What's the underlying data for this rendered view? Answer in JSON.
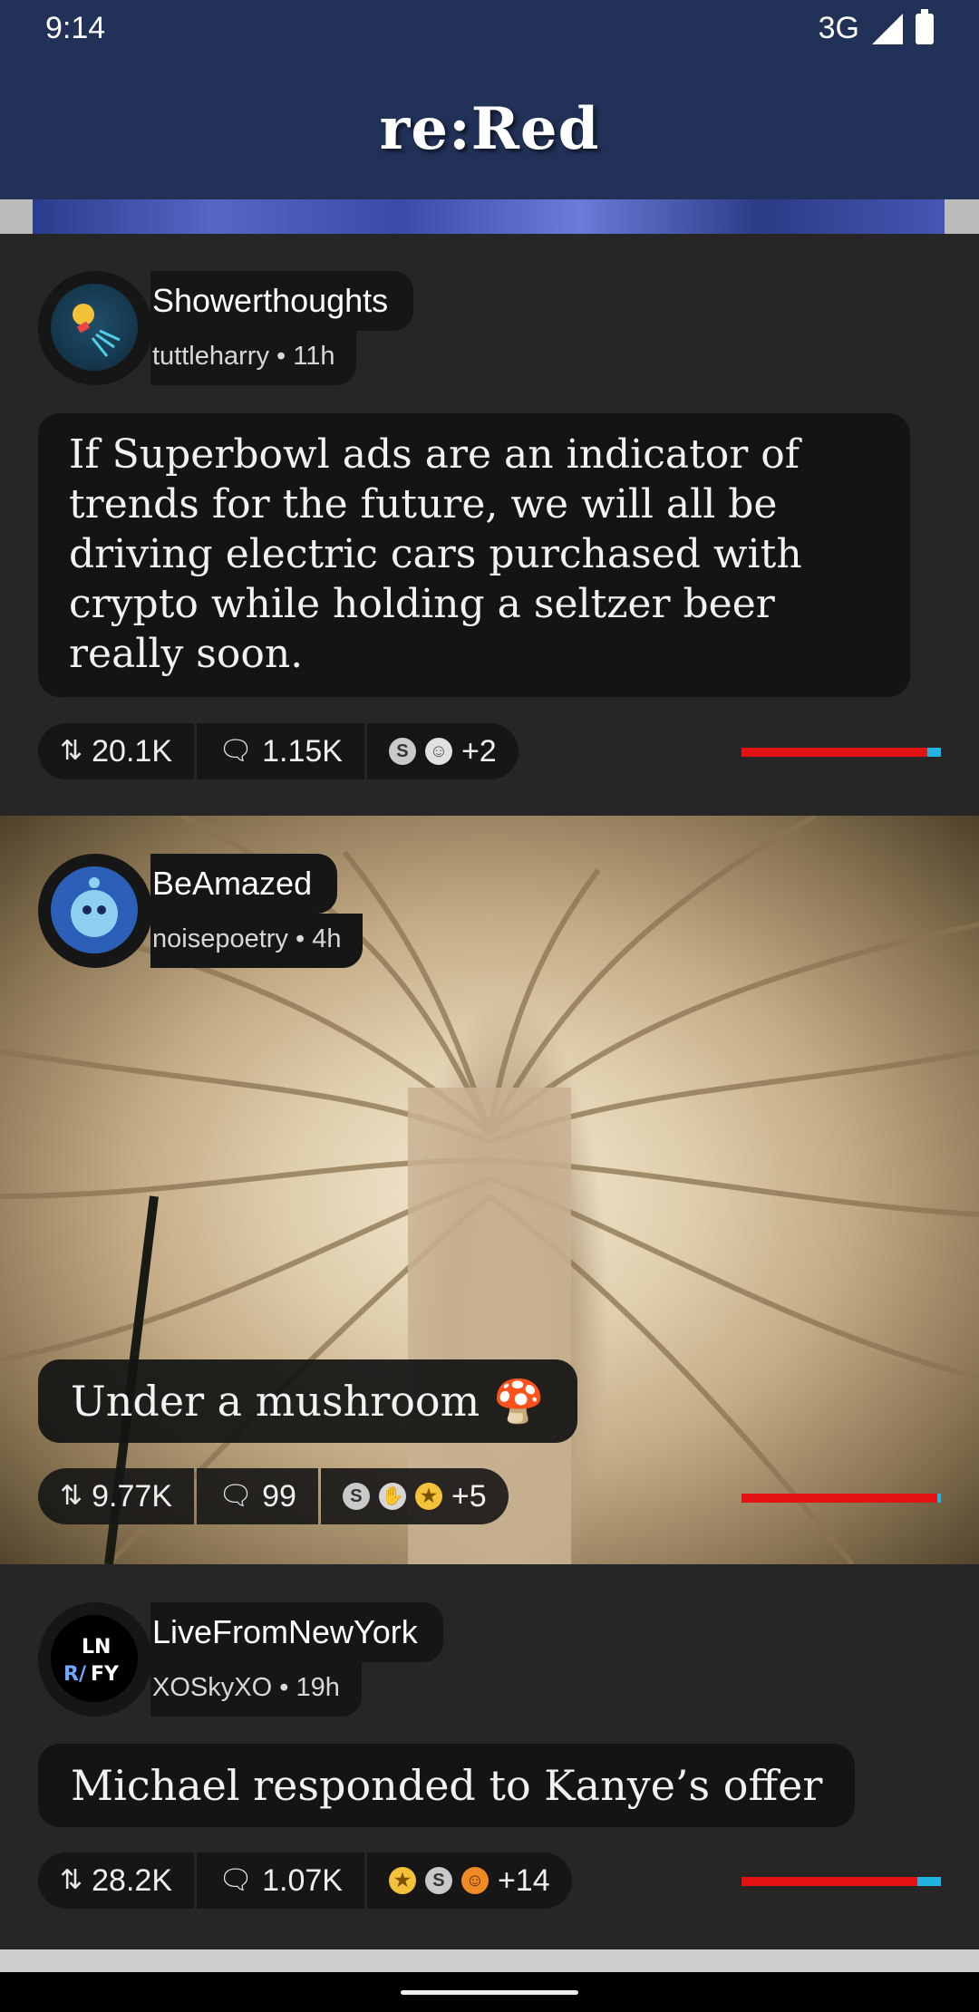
{
  "status": {
    "time": "9:14",
    "network": "3G"
  },
  "app": {
    "title": "re:Red"
  },
  "posts": [
    {
      "subreddit": "Showerthoughts",
      "author": "tuttleharry",
      "age": "11h",
      "title": "If Superbowl ads are an indicator of trends for the future, we will all be driving electric cars purchased with crypto while holding a seltzer beer really soon.",
      "score": "20.1K",
      "comments": "1.15K",
      "awards_more": "+2",
      "upvote_ratio": 0.93
    },
    {
      "subreddit": "BeAmazed",
      "author": "noisepoetry",
      "age": "4h",
      "title": "Under a mushroom 🍄",
      "score": "9.77K",
      "comments": "99",
      "awards_more": "+5",
      "upvote_ratio": 0.98
    },
    {
      "subreddit": "LiveFromNewYork",
      "author": "XOSkyXO",
      "age": "19h",
      "title": "Michael responded to Kanye’s offer",
      "score": "28.2K",
      "comments": "1.07K",
      "awards_more": "+14",
      "upvote_ratio": 0.88
    }
  ],
  "colors": {
    "appbar": "#223158",
    "ratio_up": "#e31313",
    "ratio_down": "#22b4e0",
    "feed_bg": "#262626"
  },
  "icons": [
    "score-arrows-icon",
    "comment-icon",
    "silver-award-icon",
    "wholesome-award-icon",
    "helpful-award-icon",
    "gold-award-icon"
  ]
}
